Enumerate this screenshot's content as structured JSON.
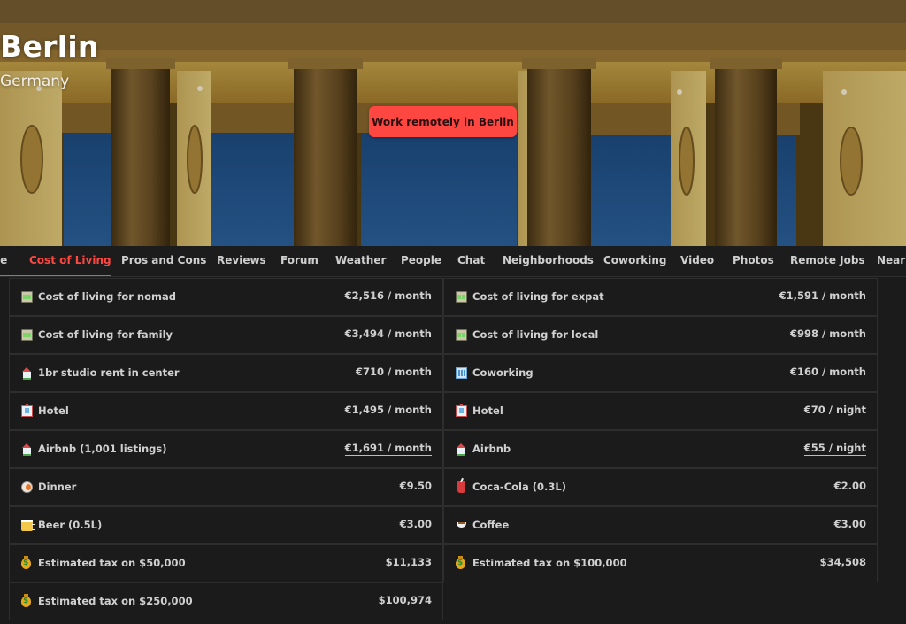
{
  "hero": {
    "city": "Berlin",
    "country": "Germany",
    "cta_label": "Work remotely in Berlin",
    "accent_color": "#ff4742"
  },
  "tabs": [
    {
      "label": "le",
      "active": false
    },
    {
      "label": "Cost of Living",
      "active": true
    },
    {
      "label": "Pros and Cons",
      "active": false
    },
    {
      "label": "Reviews",
      "active": false
    },
    {
      "label": "Forum",
      "active": false
    },
    {
      "label": "Weather",
      "active": false
    },
    {
      "label": "People",
      "active": false
    },
    {
      "label": "Chat",
      "active": false
    },
    {
      "label": "Neighborhoods",
      "active": false
    },
    {
      "label": "Coworking",
      "active": false
    },
    {
      "label": "Video",
      "active": false
    },
    {
      "label": "Photos",
      "active": false
    },
    {
      "label": "Remote Jobs",
      "active": false
    },
    {
      "label": "Near",
      "active": false
    }
  ],
  "cost_table": {
    "left": [
      {
        "icon": "money-icon",
        "label": "Cost of living for nomad",
        "value": "€2,516 / month",
        "link": false
      },
      {
        "icon": "money-icon",
        "label": "Cost of living for family",
        "value": "€3,494 / month",
        "link": false
      },
      {
        "icon": "house-icon",
        "label": "1br studio rent in center",
        "value": "€710 / month",
        "link": false
      },
      {
        "icon": "hotel-icon",
        "label": "Hotel",
        "value": "€1,495 / month",
        "link": false
      },
      {
        "icon": "house-icon",
        "label": "Airbnb (1,001 listings)",
        "value": "€1,691 / month",
        "link": true
      },
      {
        "icon": "dinner-icon",
        "label": "Dinner",
        "value": "€9.50",
        "link": false
      },
      {
        "icon": "beer-icon",
        "label": "Beer (0.5L)",
        "value": "€3.00",
        "link": false
      },
      {
        "icon": "moneybag-icon",
        "label": "Estimated tax on $50,000",
        "value": "$11,133",
        "link": false
      },
      {
        "icon": "moneybag-icon",
        "label": "Estimated tax on $250,000",
        "value": "$100,974",
        "link": false
      }
    ],
    "right": [
      {
        "icon": "money-icon",
        "label": "Cost of living for expat",
        "value": "€1,591 / month",
        "link": false
      },
      {
        "icon": "money-icon",
        "label": "Cost of living for local",
        "value": "€998 / month",
        "link": false
      },
      {
        "icon": "office-icon",
        "label": "Coworking",
        "value": "€160 / month",
        "link": false
      },
      {
        "icon": "hotel-icon",
        "label": "Hotel",
        "value": "€70 / night",
        "link": false
      },
      {
        "icon": "house-icon",
        "label": "Airbnb",
        "value": "€55 / night",
        "link": true
      },
      {
        "icon": "cola-icon",
        "label": "Coca-Cola (0.3L)",
        "value": "€2.00",
        "link": false
      },
      {
        "icon": "coffee-icon",
        "label": "Coffee",
        "value": "€3.00",
        "link": false
      },
      {
        "icon": "moneybag-icon",
        "label": "Estimated tax on $100,000",
        "value": "$34,508",
        "link": false
      }
    ]
  }
}
